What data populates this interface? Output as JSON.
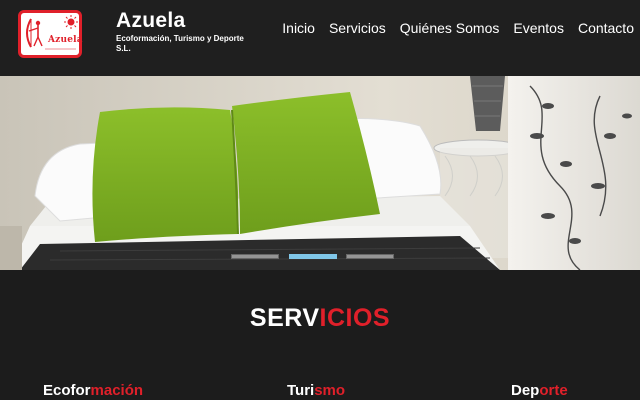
{
  "brand": {
    "logo_text": "Azuela",
    "title": "Azuela",
    "subtitle": "Ecoformación, Turismo y Deporte S.L."
  },
  "nav": {
    "items": [
      "Inicio",
      "Servicios",
      "Quiénes Somos",
      "Eventos",
      "Contacto"
    ]
  },
  "carousel": {
    "slide_count": 3,
    "active_index": 1
  },
  "services": {
    "title_part1": "SERV",
    "title_part2": "ICIOS",
    "columns": [
      {
        "part1": "Ecofor",
        "part2": "mación"
      },
      {
        "part1": "Turi",
        "part2": "smo"
      },
      {
        "part1": "Dep",
        "part2": "orte"
      }
    ]
  },
  "colors": {
    "accent": "#e0202a",
    "background": "#1c1c1c",
    "indicator_active": "#7fc6e8"
  }
}
